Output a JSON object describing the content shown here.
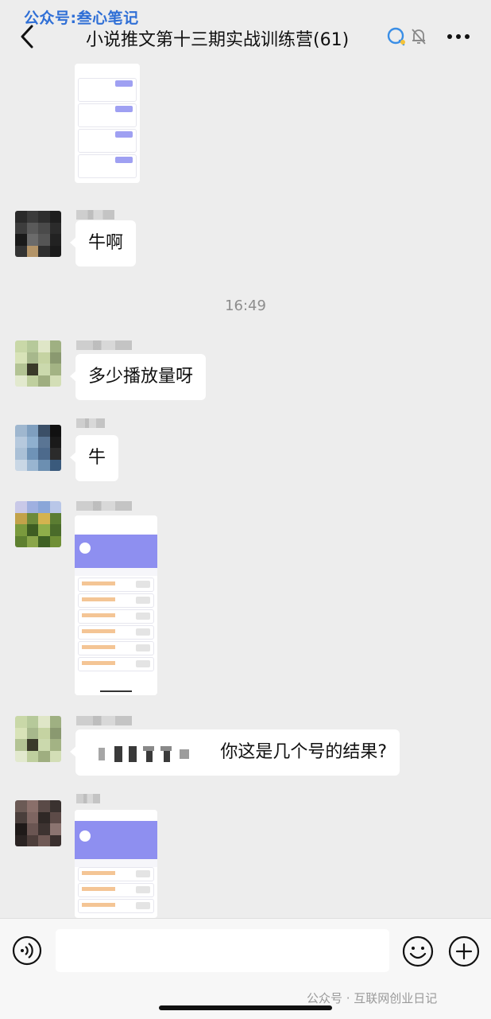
{
  "watermark_top": "公众号:叁心笔记",
  "header": {
    "title": "小说推文第十三期实战训练营(61)"
  },
  "timestamp": "16:49",
  "messages": [
    {
      "text": "牛啊"
    },
    {
      "text": "多少播放量呀"
    },
    {
      "text": "牛"
    },
    {
      "text": "你这是几个号的结果?"
    }
  ],
  "watermark_bottom": "公众号 · 互联网创业日记",
  "colors": {
    "background": "#ededed",
    "bubble": "#ffffff",
    "watermark_blue": "#2f6fd6",
    "thumbnail_accent": "#8e8ff0"
  },
  "icons": [
    "back-icon",
    "chat-bubble-icon",
    "mute-bell-icon",
    "more-icon",
    "voice-icon",
    "emoji-icon",
    "plus-icon"
  ]
}
